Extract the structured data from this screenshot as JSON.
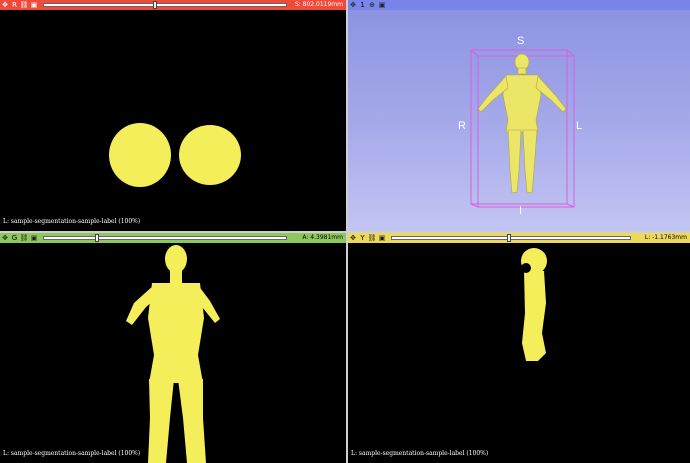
{
  "views": {
    "red": {
      "letter": "R",
      "offset": "S: 802.0119mm",
      "slider_fraction": 0.46,
      "label": "L: sample-segmentation-sample-label (100%)"
    },
    "threed": {
      "letter": "1",
      "axis_top": "S",
      "axis_bottom": "I",
      "axis_left": "R",
      "axis_right": "L"
    },
    "green": {
      "letter": "G",
      "offset": "A: 4.3981mm",
      "slider_fraction": 0.22,
      "label": "L: sample-segmentation-sample-label (100%)"
    },
    "yellow": {
      "letter": "Y",
      "offset": "L: -1.1763mm",
      "slider_fraction": 0.49,
      "label": "L: sample-segmentation-sample-label (100%)"
    }
  },
  "colors": {
    "segment": "#f3ee5a",
    "box": "#d95fe0",
    "red_bar": "#ef4a3a",
    "blue_bar": "#7a85ea",
    "green_bar": "#8dc85c",
    "yellow_bar": "#eed85c"
  }
}
